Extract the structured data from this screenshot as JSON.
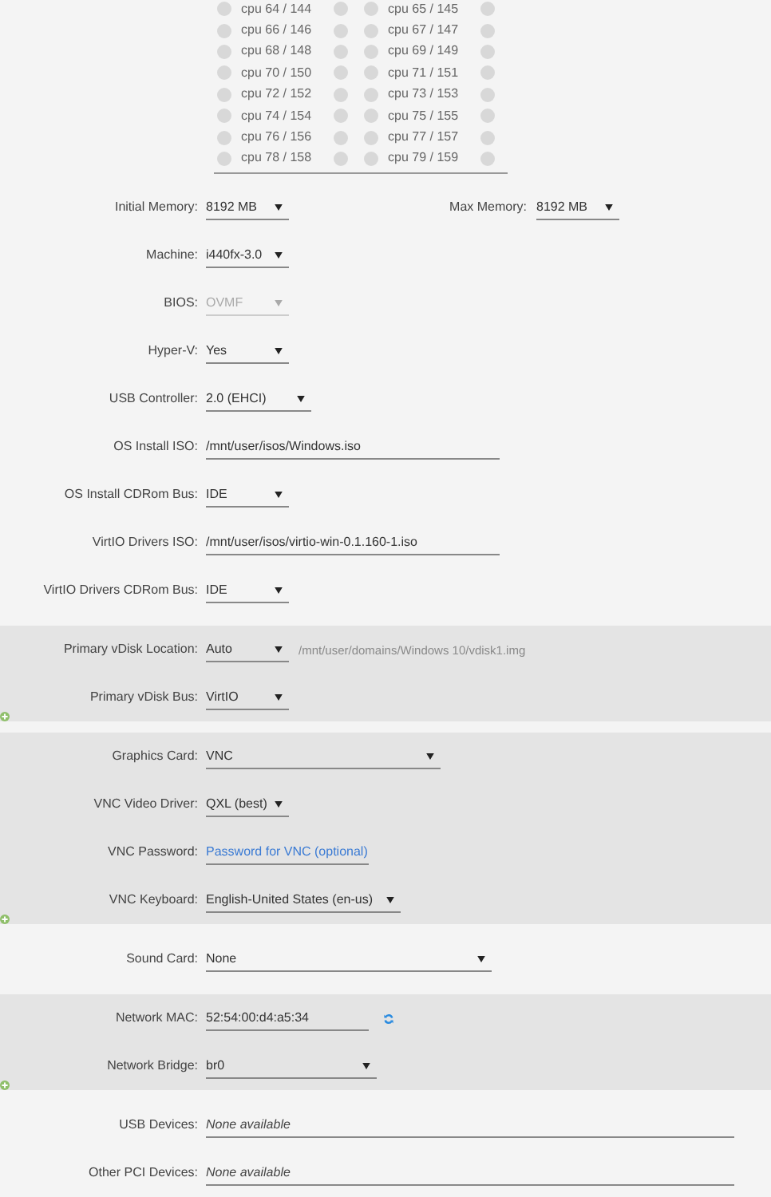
{
  "cpu_pins": [
    {
      "label": "cpu 64 / 144",
      "checked": false,
      "ht_checked": false
    },
    {
      "label": "cpu 65 / 145",
      "checked": false,
      "ht_checked": false
    },
    {
      "label": "cpu 66 / 146",
      "checked": false,
      "ht_checked": false
    },
    {
      "label": "cpu 67 / 147",
      "checked": false,
      "ht_checked": false
    },
    {
      "label": "cpu 68 / 148",
      "checked": false,
      "ht_checked": false
    },
    {
      "label": "cpu 69 / 149",
      "checked": false,
      "ht_checked": false
    },
    {
      "label": "cpu 70 / 150",
      "checked": false,
      "ht_checked": false
    },
    {
      "label": "cpu 71 / 151",
      "checked": false,
      "ht_checked": false
    },
    {
      "label": "cpu 72 / 152",
      "checked": false,
      "ht_checked": false
    },
    {
      "label": "cpu 73 / 153",
      "checked": false,
      "ht_checked": false
    },
    {
      "label": "cpu 74 / 154",
      "checked": false,
      "ht_checked": false
    },
    {
      "label": "cpu 75 / 155",
      "checked": false,
      "ht_checked": false
    },
    {
      "label": "cpu 76 / 156",
      "checked": false,
      "ht_checked": false
    },
    {
      "label": "cpu 77 / 157",
      "checked": false,
      "ht_checked": false
    },
    {
      "label": "cpu 78 / 158",
      "checked": false,
      "ht_checked": false
    },
    {
      "label": "cpu 79 / 159",
      "checked": false,
      "ht_checked": false
    }
  ],
  "sections": [
    {
      "shaded": false,
      "add_button": false,
      "rows": [
        {
          "label": "Initial Memory:",
          "kind": "select",
          "value": "8192 MB",
          "disabled": false,
          "extra": {
            "label": "Max Memory:",
            "value": "8192 MB"
          }
        },
        {
          "label": "Machine:",
          "kind": "select",
          "value": "i440fx-3.0",
          "disabled": false
        },
        {
          "label": "BIOS:",
          "kind": "select",
          "value": "OVMF",
          "disabled": true
        },
        {
          "label": "Hyper-V:",
          "kind": "select",
          "value": "Yes",
          "disabled": false
        },
        {
          "label": "USB Controller:",
          "kind": "select",
          "value": "2.0 (EHCI)",
          "disabled": false
        },
        {
          "label": "OS Install ISO:",
          "kind": "text",
          "value": "/mnt/user/isos/Windows.iso"
        },
        {
          "label": "OS Install CDRom Bus:",
          "kind": "select",
          "value": "IDE",
          "disabled": false
        },
        {
          "label": "VirtIO Drivers ISO:",
          "kind": "text",
          "value": "/mnt/user/isos/virtio-win-0.1.160-1.iso"
        },
        {
          "label": "VirtIO Drivers CDRom Bus:",
          "kind": "select",
          "value": "IDE",
          "disabled": false
        }
      ]
    },
    {
      "shaded": true,
      "add_button": true,
      "rows": [
        {
          "label": "Primary vDisk Location:",
          "kind": "select",
          "value": "Auto",
          "disabled": false,
          "note": "/mnt/user/domains/Windows 10/vdisk1.img"
        },
        {
          "label": "Primary vDisk Bus:",
          "kind": "select",
          "value": "VirtIO",
          "disabled": false
        }
      ]
    },
    {
      "shaded": true,
      "add_button": true,
      "rows": [
        {
          "label": "Graphics Card:",
          "kind": "select",
          "value": "VNC",
          "disabled": false
        },
        {
          "label": "VNC Video Driver:",
          "kind": "select",
          "value": "QXL (best)",
          "disabled": false
        },
        {
          "label": "VNC Password:",
          "kind": "password",
          "placeholder": "Password for VNC (optional)"
        },
        {
          "label": "VNC Keyboard:",
          "kind": "select",
          "value": "English-United States (en-us)",
          "disabled": false
        }
      ]
    },
    {
      "shaded": false,
      "add_button": false,
      "rows": [
        {
          "label": "Sound Card:",
          "kind": "select",
          "value": "None",
          "disabled": false
        }
      ]
    },
    {
      "shaded": true,
      "add_button": true,
      "rows": [
        {
          "label": "Network MAC:",
          "kind": "mac",
          "value": "52:54:00:d4:a5:34"
        },
        {
          "label": "Network Bridge:",
          "kind": "select",
          "value": "br0",
          "disabled": false
        }
      ]
    },
    {
      "shaded": false,
      "add_button": false,
      "rows": [
        {
          "label": "USB Devices:",
          "kind": "static",
          "value": "None available"
        },
        {
          "label": "Other PCI Devices:",
          "kind": "static",
          "value": "None available"
        }
      ]
    }
  ]
}
